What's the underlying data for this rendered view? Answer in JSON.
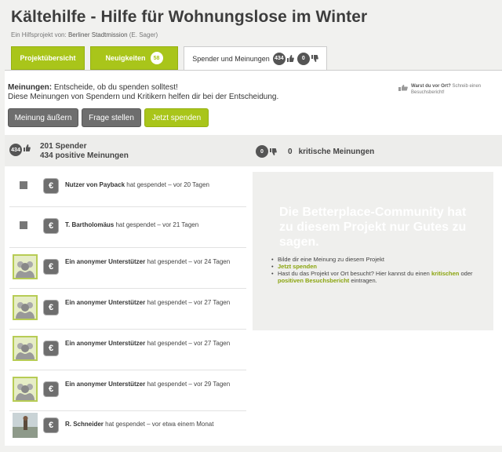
{
  "header": {
    "title": "Kältehilfe - Hilfe für Wohnungslose im Winter",
    "subtitle_prefix": "Ein Hilfsprojekt von:",
    "org": "Berliner Stadtmission",
    "person": "(E. Sager)"
  },
  "tabs": [
    {
      "label": "Projektübersicht"
    },
    {
      "label": "Neuigkeiten",
      "count": "58"
    },
    {
      "label": "Spender und Meinungen",
      "positive": "434",
      "negative": "0"
    }
  ],
  "intro": {
    "bold": "Meinungen:",
    "line1": "Entscheide, ob du spenden solltest!",
    "line2": "Diese Meinungen von Spendern und Kritikern helfen dir bei der Entscheidung."
  },
  "visit": {
    "bold": "Warst du vor Ort?",
    "text": "Schreib einen Besuchsbericht!"
  },
  "buttons": {
    "opinion": "Meinung äußern",
    "question": "Frage stellen",
    "donate": "Jetzt spenden"
  },
  "stats": {
    "positive_badge": "434",
    "donors": "201 Spender",
    "positive": "434 positive Meinungen",
    "negative_badge": "0",
    "negative_count": "0",
    "negative_label": "kritische Meinungen"
  },
  "donors": [
    {
      "name": "Nutzer von Payback",
      "text": "hat gespendet – vor 20 Tagen",
      "avatar": "square"
    },
    {
      "name": "T. Bartholomäus",
      "text": "hat gespendet – vor 21 Tagen",
      "avatar": "square"
    },
    {
      "name": "Ein anonymer Unterstützer",
      "text": "hat gespendet – vor 24 Tagen",
      "avatar": "group"
    },
    {
      "name": "Ein anonymer Unterstützer",
      "text": "hat gespendet – vor 27 Tagen",
      "avatar": "group"
    },
    {
      "name": "Ein anonymer Unterstützer",
      "text": "hat gespendet – vor 27 Tagen",
      "avatar": "group"
    },
    {
      "name": "Ein anonymer Unterstützer",
      "text": "hat gespendet – vor 29 Tagen",
      "avatar": "group"
    },
    {
      "name": "R. Schneider",
      "text": "hat gespendet – vor etwa einem Monat",
      "avatar": "photo"
    }
  ],
  "right": {
    "message": "Die Betterplace-Community hat zu diesem Projekt nur Gutes zu sagen.",
    "tip1": "Bilde dir eine Meinung zu diesem Projekt",
    "tip2": "Jetzt spenden",
    "tip3_a": "Hast du das Projekt vor Ort besucht? Hier kannst du einen",
    "tip3_critical": "kritischen",
    "tip3_or": "oder",
    "tip3_positive": "positiven Besuchsbericht",
    "tip3_end": "eintragen."
  },
  "colors": {
    "accent": "#a9c51a",
    "button_gray": "#6e6e6e",
    "background": "#f1f1ef"
  },
  "euro_symbol": "€"
}
